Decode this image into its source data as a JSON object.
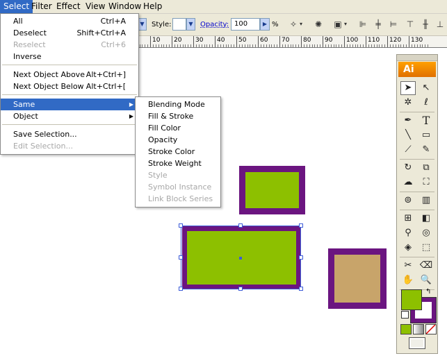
{
  "menubar": {
    "items": [
      {
        "label": "Select",
        "active": true
      },
      {
        "label": "Filter"
      },
      {
        "label": "Effect"
      },
      {
        "label": "View"
      },
      {
        "label": "Window"
      },
      {
        "label": "Help"
      }
    ]
  },
  "controlbar": {
    "style_label": "Style:",
    "opacity_label": "Opacity:",
    "opacity_value": "100",
    "percent": "%"
  },
  "ruler": {
    "labels": [
      "0",
      "10",
      "20",
      "30",
      "40",
      "50",
      "60",
      "70",
      "80",
      "90",
      "100",
      "110",
      "120",
      "130"
    ]
  },
  "select_menu": {
    "items": [
      {
        "label": "All",
        "shortcut": "Ctrl+A"
      },
      {
        "label": "Deselect",
        "shortcut": "Shift+Ctrl+A"
      },
      {
        "label": "Reselect",
        "shortcut": "Ctrl+6",
        "disabled": true
      },
      {
        "label": "Inverse",
        "shortcut": ""
      },
      {
        "label": "Next Object Above",
        "shortcut": "Alt+Ctrl+]"
      },
      {
        "label": "Next Object Below",
        "shortcut": "Alt+Ctrl+["
      },
      {
        "label": "Same",
        "submenu": true,
        "highlighted": true
      },
      {
        "label": "Object",
        "submenu": true
      },
      {
        "label": "Save Selection...",
        "shortcut": ""
      },
      {
        "label": "Edit Selection...",
        "shortcut": "",
        "disabled": true
      }
    ]
  },
  "same_submenu": {
    "items": [
      {
        "label": "Blending Mode"
      },
      {
        "label": "Fill & Stroke"
      },
      {
        "label": "Fill Color"
      },
      {
        "label": "Opacity"
      },
      {
        "label": "Stroke Color"
      },
      {
        "label": "Stroke Weight"
      },
      {
        "label": "Style",
        "disabled": true
      },
      {
        "label": "Symbol Instance",
        "disabled": true
      },
      {
        "label": "Link Block Series",
        "disabled": true
      }
    ]
  },
  "tools": {
    "logo": "Ai",
    "icons": [
      "selection-arrow-icon",
      "direct-selection-icon",
      "magic-wand-icon",
      "lasso-icon",
      "pen-icon",
      "type-icon",
      "line-icon",
      "rectangle-icon",
      "paintbrush-icon",
      "pencil-icon",
      "rotate-icon",
      "scale-icon",
      "warp-icon",
      "free-transform-icon",
      "symbol-sprayer-icon",
      "graph-icon",
      "mesh-icon",
      "gradient-icon",
      "eyedropper-icon",
      "blend-icon",
      "live-paint-icon",
      "live-paint-selection-icon",
      "slice-icon",
      "eraser-icon",
      "hand-icon",
      "zoom-icon"
    ],
    "fill_color": "#8dc000",
    "stroke_color": "#6b1580"
  },
  "colors": {
    "accent": "#316ac5",
    "shape_fill": "#8dc000",
    "shape_stroke": "#6b1580",
    "tan_fill": "#c8a46a",
    "selection": "#3c5bd8"
  }
}
